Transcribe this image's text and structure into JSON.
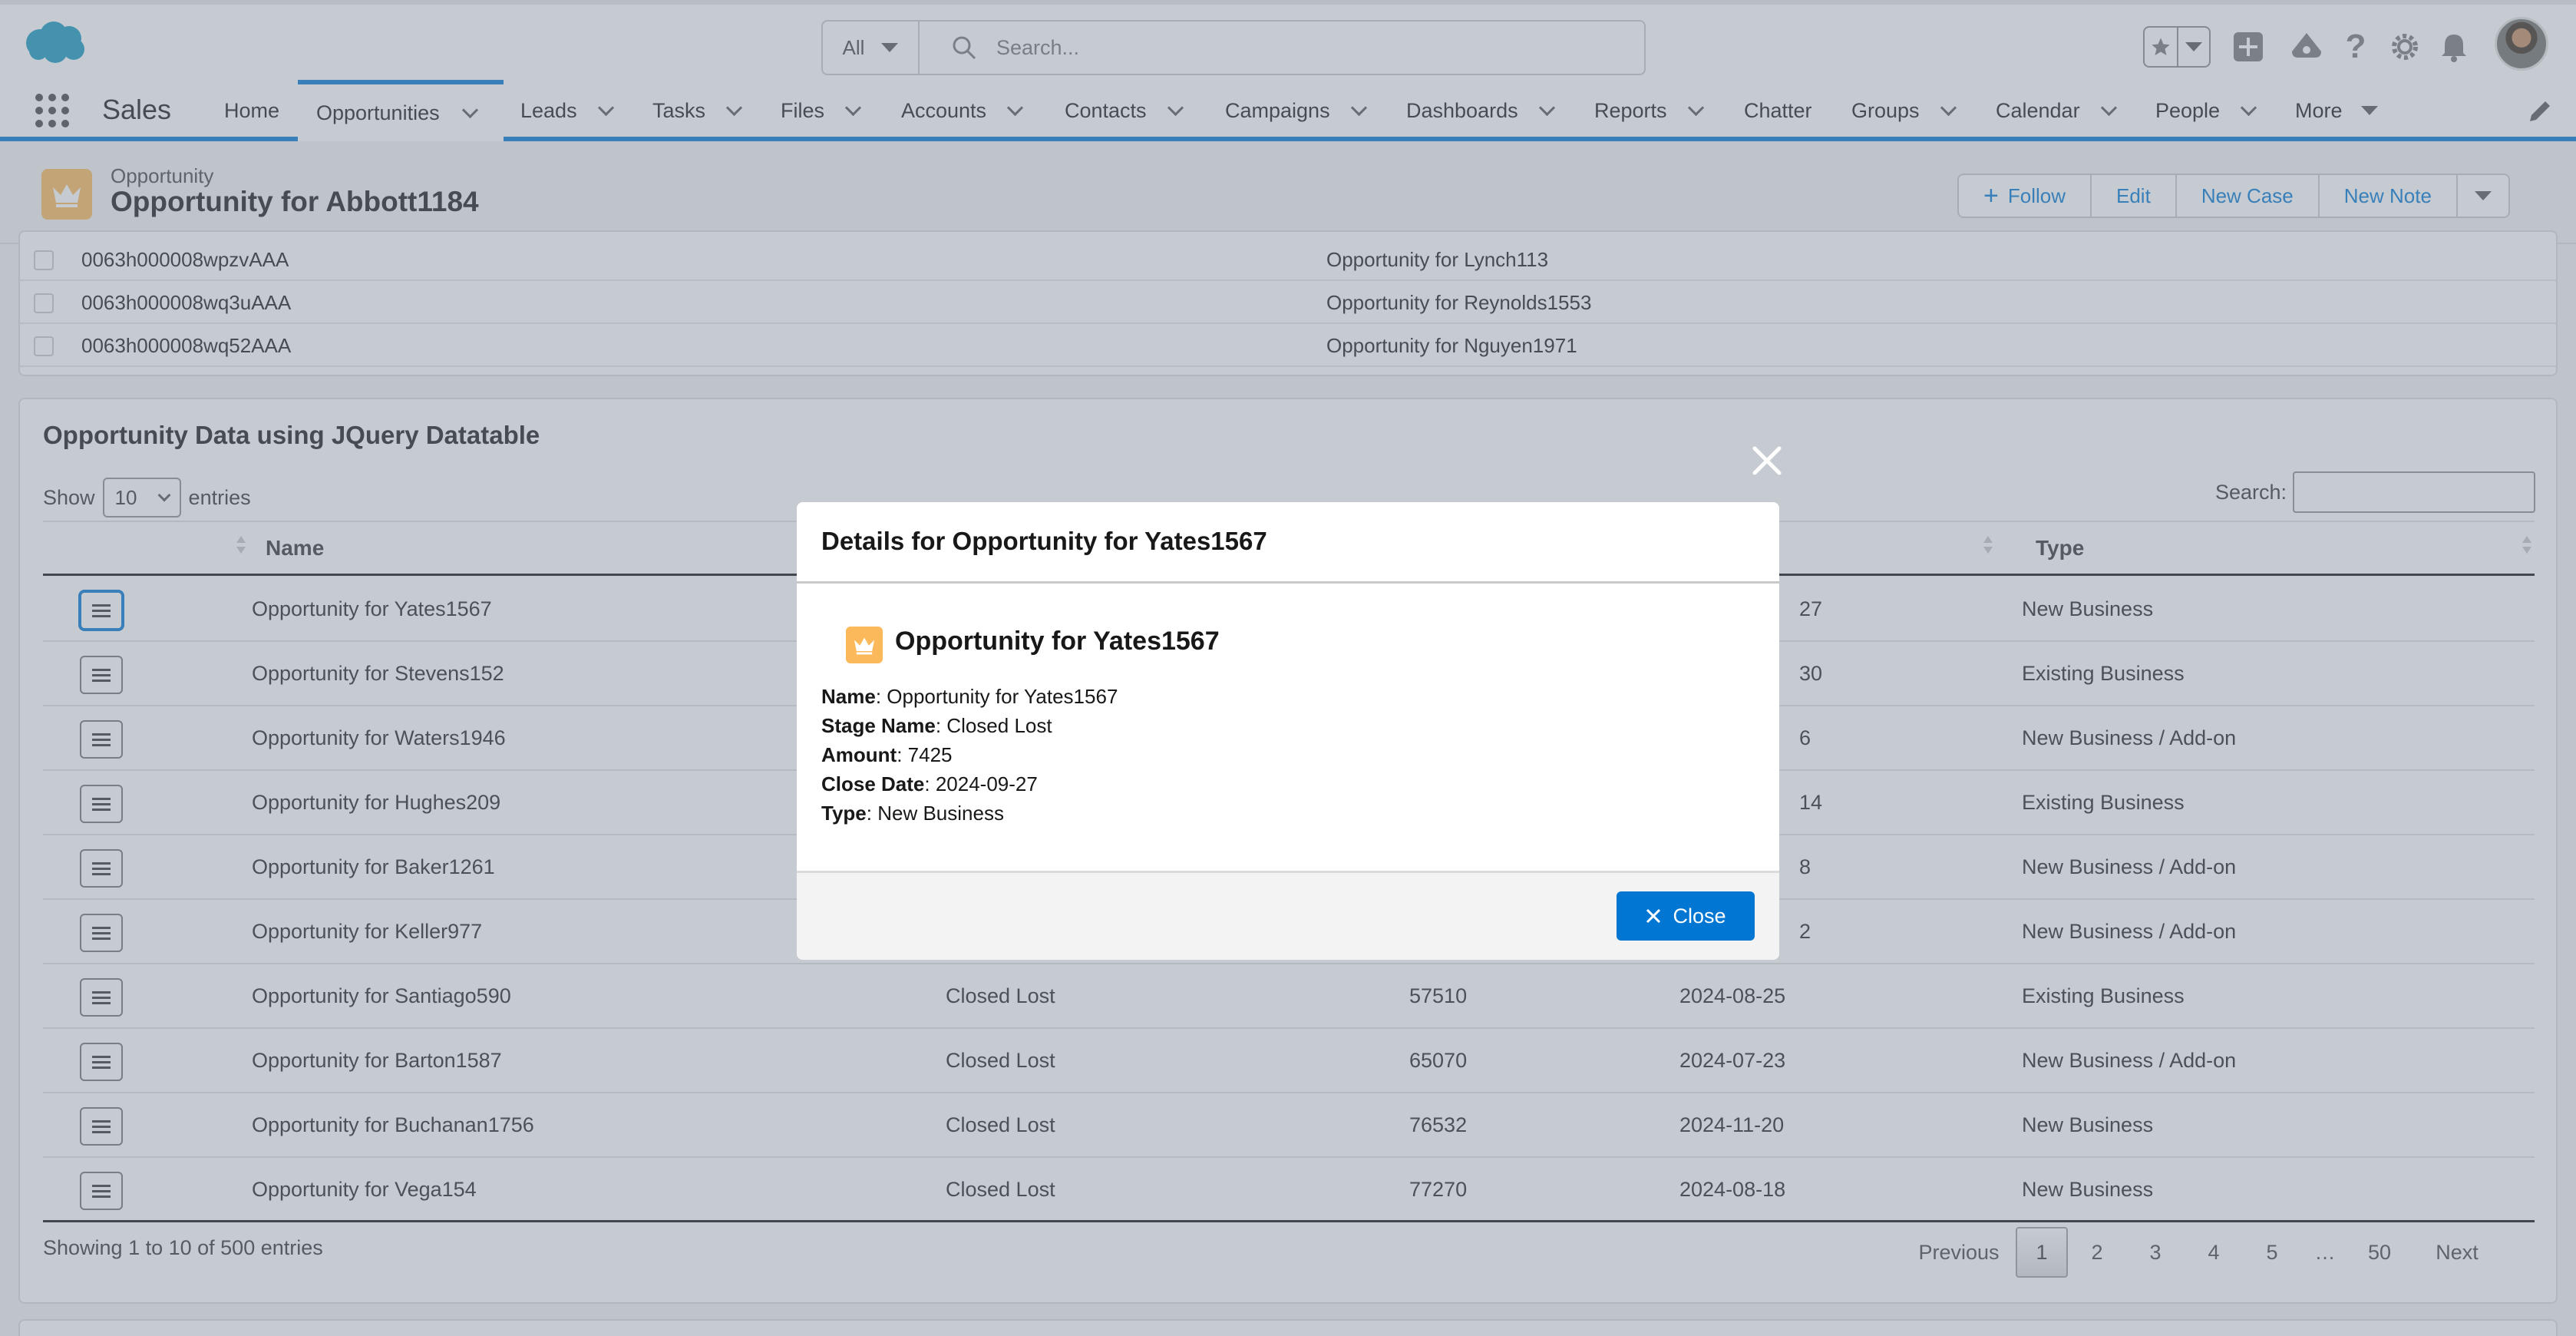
{
  "global_search": {
    "scope": "All",
    "placeholder": "Search..."
  },
  "nav": {
    "app_name": "Sales",
    "items": [
      {
        "label": "Home",
        "dropdown": false
      },
      {
        "label": "Opportunities",
        "dropdown": true,
        "active": true
      },
      {
        "label": "Leads",
        "dropdown": true
      },
      {
        "label": "Tasks",
        "dropdown": true
      },
      {
        "label": "Files",
        "dropdown": true
      },
      {
        "label": "Accounts",
        "dropdown": true
      },
      {
        "label": "Contacts",
        "dropdown": true
      },
      {
        "label": "Campaigns",
        "dropdown": true
      },
      {
        "label": "Dashboards",
        "dropdown": true
      },
      {
        "label": "Reports",
        "dropdown": true
      },
      {
        "label": "Chatter",
        "dropdown": false
      },
      {
        "label": "Groups",
        "dropdown": true
      },
      {
        "label": "Calendar",
        "dropdown": true
      },
      {
        "label": "People",
        "dropdown": true
      },
      {
        "label": "More",
        "dropdown": true
      }
    ]
  },
  "record": {
    "type": "Opportunity",
    "title": "Opportunity for Abbott1184",
    "actions": {
      "follow": "Follow",
      "edit": "Edit",
      "new_case": "New Case",
      "new_note": "New Note"
    }
  },
  "top_list": {
    "rows": [
      {
        "id": "0063h000008wpzvAAA",
        "name": "Opportunity for Lynch113"
      },
      {
        "id": "0063h000008wq3uAAA",
        "name": "Opportunity for Reynolds1553"
      },
      {
        "id": "0063h000008wq52AAA",
        "name": "Opportunity for Nguyen1971"
      }
    ]
  },
  "datatable": {
    "title": "Opportunity Data using JQuery Datatable",
    "show_label": "Show",
    "page_size": "10",
    "entries_label": "entries",
    "search_label": "Search:",
    "columns": {
      "name": "Name",
      "close_date_partial": "te",
      "type": "Type"
    },
    "rows": [
      {
        "name": "Opportunity for Yates1567",
        "stage": "",
        "amount": "",
        "date": "27",
        "type": "New Business"
      },
      {
        "name": "Opportunity for Stevens152",
        "stage": "",
        "amount": "",
        "date": "30",
        "type": "Existing Business"
      },
      {
        "name": "Opportunity for Waters1946",
        "stage": "",
        "amount": "",
        "date": "6",
        "type": "New Business / Add-on"
      },
      {
        "name": "Opportunity for Hughes209",
        "stage": "",
        "amount": "",
        "date": "14",
        "type": "Existing Business"
      },
      {
        "name": "Opportunity for Baker1261",
        "stage": "",
        "amount": "",
        "date": "8",
        "type": "New Business / Add-on"
      },
      {
        "name": "Opportunity for Keller977",
        "stage": "",
        "amount": "",
        "date": "2",
        "type": "New Business / Add-on"
      },
      {
        "name": "Opportunity for Santiago590",
        "stage": "Closed Lost",
        "amount": "57510",
        "date": "2024-08-25",
        "type": "Existing Business"
      },
      {
        "name": "Opportunity for Barton1587",
        "stage": "Closed Lost",
        "amount": "65070",
        "date": "2024-07-23",
        "type": "New Business / Add-on"
      },
      {
        "name": "Opportunity for Buchanan1756",
        "stage": "Closed Lost",
        "amount": "76532",
        "date": "2024-11-20",
        "type": "New Business"
      },
      {
        "name": "Opportunity for Vega154",
        "stage": "Closed Lost",
        "amount": "77270",
        "date": "2024-08-18",
        "type": "New Business"
      }
    ],
    "info": "Showing 1 to 10 of 500 entries",
    "pager": {
      "previous": "Previous",
      "pages": [
        "1",
        "2",
        "3",
        "4",
        "5",
        "…",
        "50"
      ],
      "current": "1",
      "next": "Next"
    }
  },
  "modal": {
    "title": "Details for Opportunity for Yates1567",
    "record_name": "Opportunity for Yates1567",
    "fields": [
      {
        "label": "Name",
        "value": "Opportunity for Yates1567"
      },
      {
        "label": "Stage Name",
        "value": "Closed Lost"
      },
      {
        "label": "Amount",
        "value": "7425"
      },
      {
        "label": "Close Date",
        "value": "2024-09-27"
      },
      {
        "label": "Type",
        "value": "New Business"
      }
    ],
    "close_label": "Close"
  },
  "colors": {
    "brand": "#0176d3",
    "opportunity_icon": "#fcb95b",
    "cloud": "#1798c1"
  }
}
